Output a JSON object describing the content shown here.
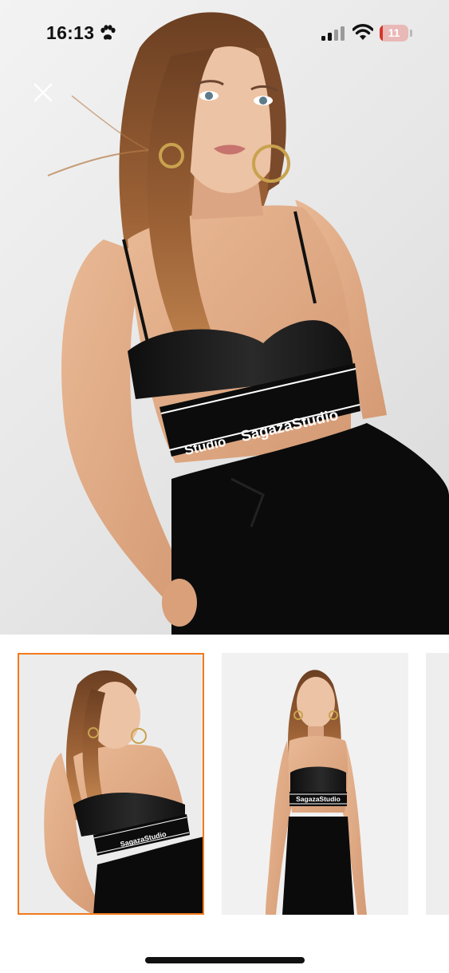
{
  "status_bar": {
    "time": "16:13",
    "battery_level": "11",
    "battery_fraction": 0.11,
    "icons": [
      "paw-icon",
      "cellular-signal-icon",
      "wifi-icon",
      "battery-icon"
    ]
  },
  "viewer": {
    "close_icon": "close-icon",
    "main_image_brand_text": "SagazaStudio",
    "main_image_brand_text_partial": "Studio"
  },
  "thumbnails": [
    {
      "brand_text": "SagazaStudio",
      "selected": true
    },
    {
      "brand_text": "SagazaStudio",
      "selected": false
    },
    {
      "brand_text": "",
      "selected": false
    }
  ],
  "colors": {
    "accent": "#f27a1a",
    "background": "#ffffff",
    "battery_red": "#d9342b"
  }
}
